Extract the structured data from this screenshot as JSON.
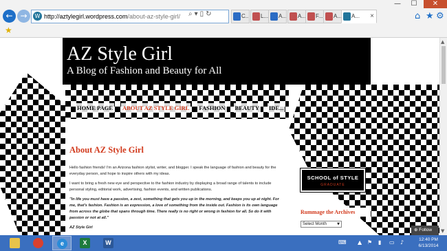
{
  "browser": {
    "url_host": "http://aztylegirl.wordpress.com",
    "url_path": "/about-az-style-girl/",
    "tabs": [
      {
        "label": "C...",
        "color": "#2b6cc4"
      },
      {
        "label": "L...",
        "color": "#c05050"
      },
      {
        "label": "A...",
        "color": "#2b6cc4"
      },
      {
        "label": "A...",
        "color": "#c05050"
      },
      {
        "label": "F...",
        "color": "#c05050"
      },
      {
        "label": "A...",
        "color": "#c05050"
      },
      {
        "label": "A...",
        "color": "#21759b"
      }
    ],
    "window_controls": {
      "minimize": "—",
      "maximize": "☐",
      "close": "✕"
    }
  },
  "site": {
    "title": "AZ Style Girl",
    "tagline": "A Blog of Fashion and Beauty for All",
    "menu": [
      "HOME PAGE",
      "ABOUT AZ STYLE GIRL",
      "FASHION",
      "BEAUTY",
      "IDE..."
    ],
    "current_menu_index": 1
  },
  "post": {
    "title": "About AZ Style Girl",
    "p1": "Hello fashion friends! I'm an Arizona fashion stylist, writer, and blogger. I speak the language of fashion and beauty for the everyday person, and hope to inspire others with my ideas.",
    "p2": "I want to bring a fresh new eye and perspective to the fashion industry by displaying a broad range of talents to include personal styling, editorial work, advertising, fashion events, and written publications.",
    "quote": "\"In life you must have a passion, a zest, something that gets you up in the morning, and keeps you up at night. For me, that's fashion.  Fashion is an expression, a love of something from the inside out.  Fashion is its own language from across the globe that spans through time.  There really is no right or wrong in fashion for all.  So do it with passion or not at all.\"",
    "signature": "AZ Style Girl"
  },
  "sidebar": {
    "school_of_style": "SCHOOL of STYLE",
    "graduate": "GRADUATE",
    "archives_title": "Rummage the Archives",
    "archive_select": "Select Month"
  },
  "follow_label": "Follow",
  "taskbar": {
    "time": "12:40 PM",
    "date": "6/13/2014"
  },
  "colors": {
    "accent": "#d23b1e",
    "taskbar": "#3a6fbf"
  }
}
